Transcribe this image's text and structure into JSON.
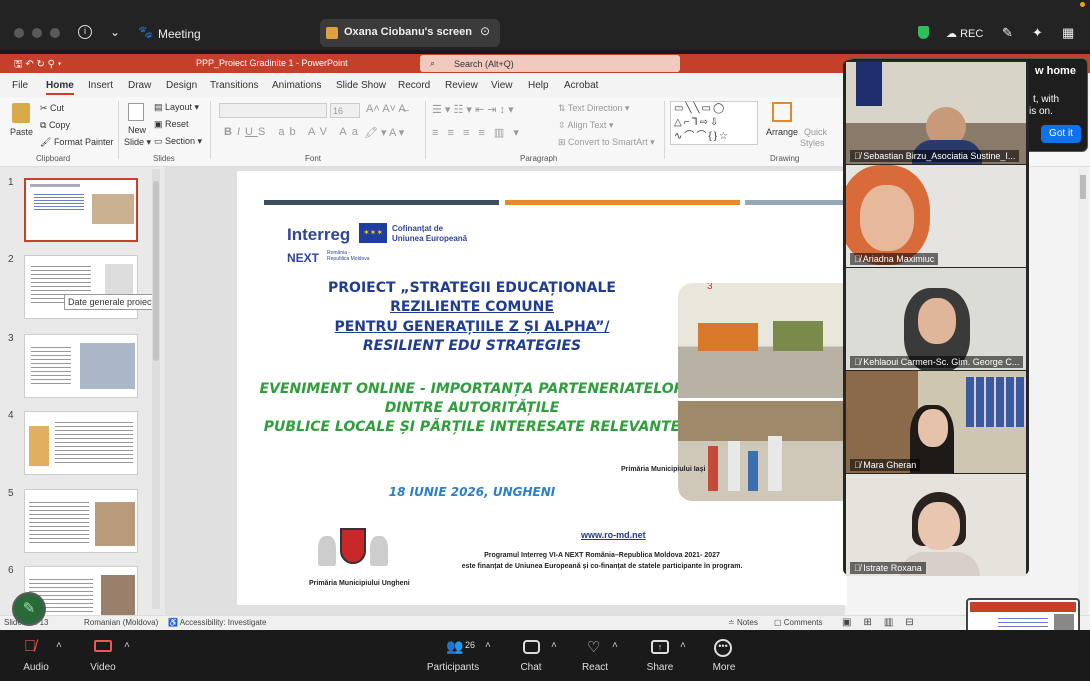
{
  "zoom": {
    "title": "Meeting",
    "share_label": "Oxana Ciobanu's screen",
    "rec_label": "REC"
  },
  "ppt": {
    "file_title": "PPP_Proiect Gradinite 1  -  PowerPoint",
    "search_placeholder": "Search (Alt+Q)",
    "menu": [
      "File",
      "Home",
      "Insert",
      "Draw",
      "Design",
      "Transitions",
      "Animations",
      "Slide Show",
      "Record",
      "Review",
      "View",
      "Help",
      "Acrobat"
    ],
    "ribbon": {
      "paste": "Paste",
      "cut": "Cut",
      "copy": "Copy",
      "format_painter": "Format Painter",
      "clipboard": "Clipboard",
      "new_slide": "New",
      "new_slide2": "Slide",
      "layout": "Layout",
      "reset": "Reset",
      "section": "Section",
      "slides": "Slides",
      "font_size": "16",
      "font": "Font",
      "text_direction": "Text Direction",
      "align_text": "Align Text",
      "smartart": "Convert to SmartArt",
      "paragraph": "Paragraph",
      "arrange": "Arrange",
      "quick": "Quick",
      "styles": "Styles",
      "drawing": "Drawing"
    },
    "thumb_numbers": [
      "1",
      "2",
      "3",
      "4",
      "5",
      "6"
    ],
    "tooltip": "Date generale proiect",
    "status": {
      "slide": "Slide 1 of 13",
      "lang": "Romanian (Moldova)",
      "accessibility": "Accessibility: Investigate",
      "notes": "Notes",
      "comments": "Comments"
    }
  },
  "slide": {
    "interreg": "Interreg",
    "cofin1": "Cofinanțat de",
    "cofin2": "Uniunea Europeană",
    "next": "NEXT",
    "next_sub1": "România -",
    "next_sub2": "Republica Moldova",
    "title_lines": [
      "PROIECT „STRATEGII EDUCAȚIONALE",
      "REZILIENTE COMUNE",
      "PENTRU GENERAȚIILE Z ȘI ALPHA”/",
      "RESILIENT EDU STRATEGIES"
    ],
    "event_lines": [
      "EVENIMENT ONLINE - IMPORTANȚA PARTENERIATELOR",
      "DINTRE AUTORITĂȚILE",
      "PUBLICE LOCALE ȘI PĂRȚILE INTERESATE RELEVANTE"
    ],
    "date": "18 IUNIE 2026, UNGHENI",
    "url": "www.ro-md.net",
    "footer1": "Programul Interreg VI-A NEXT România–Republica Moldova 2021- 2027",
    "footer2": "este finanțat de Uniunea Europeană și co-finanțat de statele participante în program.",
    "mayor_left": "Primăria Municipiului Ungheni",
    "mayor_right": "Primăria Municipiului Iași",
    "photo_num": "3"
  },
  "popup": {
    "line1": "w home",
    "line2": "t, with",
    "line3": "is on.",
    "button": "Got it"
  },
  "participants": [
    {
      "name": "Sebastian Birzu_Asociatia Sustine_I..."
    },
    {
      "name": "Ariadna Maximiuc"
    },
    {
      "name": "Kehlaoui Carmen-Sc. Gim. George C..."
    },
    {
      "name": "Mara Gheran"
    },
    {
      "name": "Istrate Roxana"
    }
  ],
  "toolbar": {
    "audio": "Audio",
    "video": "Video",
    "participants": "Participants",
    "participant_count": "26",
    "chat": "Chat",
    "react": "React",
    "share": "Share",
    "more": "More"
  },
  "colors": {
    "ppt_red": "#c4402a",
    "title_blue": "#1f3c8f",
    "event_green": "#2e9e3a",
    "date_blue": "#2b7fc9"
  }
}
